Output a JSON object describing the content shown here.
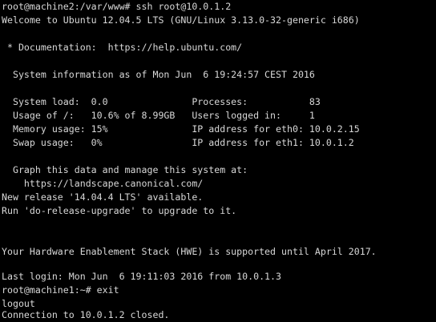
{
  "terminal": {
    "lines": [
      "root@machine2:/var/www# ssh root@10.0.1.2",
      "Welcome to Ubuntu 12.04.5 LTS (GNU/Linux 3.13.0-32-generic i686)",
      "",
      " * Documentation:  https://help.ubuntu.com/",
      "",
      "  System information as of Mon Jun  6 19:24:57 CEST 2016",
      "",
      "  System load:  0.0               Processes:           83",
      "  Usage of /:   10.6% of 8.99GB   Users logged in:     1",
      "  Memory usage: 15%               IP address for eth0: 10.0.2.15",
      "  Swap usage:   0%                IP address for eth1: 10.0.1.2",
      "",
      "  Graph this data and manage this system at:",
      "    https://landscape.canonical.com/",
      "",
      "New release '14.04.4 LTS' available.",
      "Run 'do-release-upgrade' to upgrade to it.",
      "",
      "",
      "Your Hardware Enablement Stack (HWE) is supported until April 2017.",
      "",
      "Last login: Mon Jun  6 19:11:03 2016 from 10.0.1.3",
      "root@machine1:~# exit",
      "logout",
      "Connection to 10.0.1.2 closed."
    ]
  }
}
